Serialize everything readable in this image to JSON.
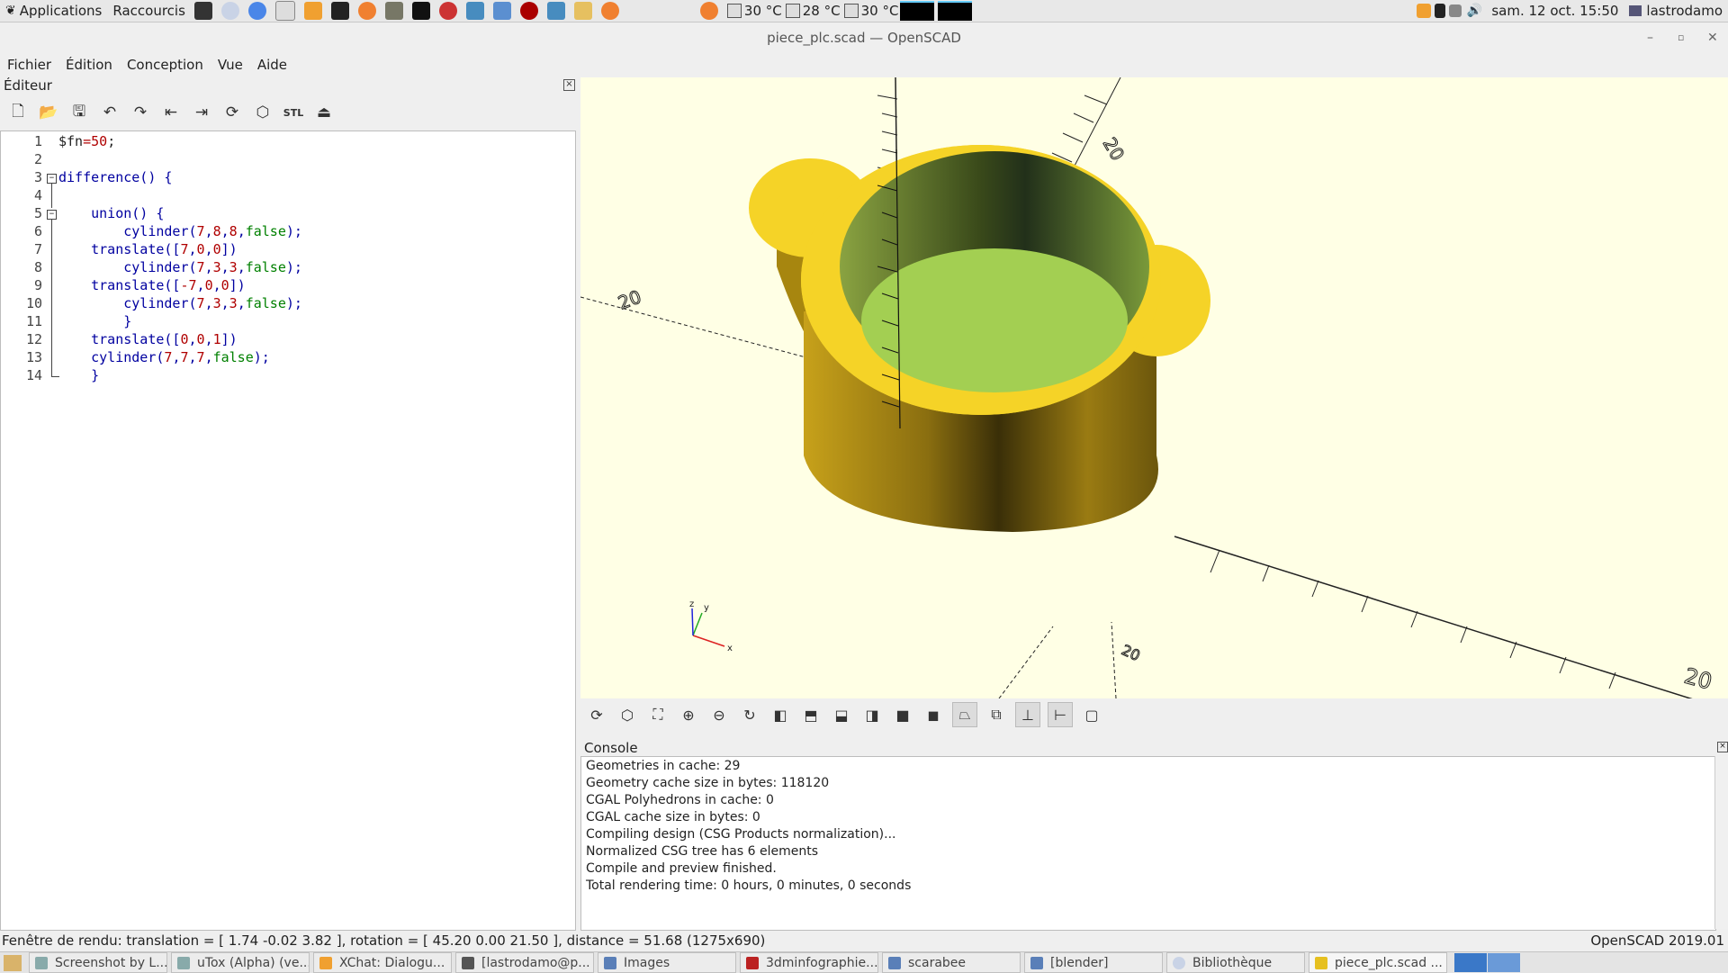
{
  "top_panel": {
    "applications": "Applications",
    "shortcuts": "Raccourcis",
    "temps": [
      "30 °C",
      "28 °C",
      "30 °C"
    ],
    "datetime": "sam. 12 oct.  15:50",
    "user": "lastrodamo"
  },
  "window": {
    "title": "piece_plc.scad — OpenSCAD"
  },
  "menubar": {
    "items": [
      "Fichier",
      "Édition",
      "Conception",
      "Vue",
      "Aide"
    ]
  },
  "editor": {
    "title": "Éditeur",
    "lines": [
      {
        "n": "1",
        "text": "$fn=50;"
      },
      {
        "n": "2",
        "text": ""
      },
      {
        "n": "3",
        "text": "difference() {"
      },
      {
        "n": "4",
        "text": ""
      },
      {
        "n": "5",
        "text": "    union() {"
      },
      {
        "n": "6",
        "text": "        cylinder(7,8,8,false);"
      },
      {
        "n": "7",
        "text": "    translate([7,0,0])"
      },
      {
        "n": "8",
        "text": "        cylinder(7,3,3,false);"
      },
      {
        "n": "9",
        "text": "    translate([-7,0,0])"
      },
      {
        "n": "10",
        "text": "        cylinder(7,3,3,false);"
      },
      {
        "n": "11",
        "text": "        }"
      },
      {
        "n": "12",
        "text": "    translate([0,0,1])"
      },
      {
        "n": "13",
        "text": "    cylinder(7,7,7,false);"
      },
      {
        "n": "14",
        "text": "    }"
      }
    ]
  },
  "viewport": {
    "axis_labels": {
      "x": "x",
      "y": "y",
      "z": "z"
    },
    "scale_labels": [
      "20",
      "20",
      "20",
      "20"
    ],
    "colors": {
      "background": "#ffffe5",
      "model_outer": "#f5d327",
      "model_inner": "#7f9a3a",
      "floor": "#a3cf52"
    }
  },
  "console": {
    "title": "Console",
    "lines": [
      "Geometries in cache: 29",
      "Geometry cache size in bytes: 118120",
      "CGAL Polyhedrons in cache: 0",
      "CGAL cache size in bytes: 0",
      "Compiling design (CSG Products normalization)...",
      "Normalized CSG tree has 6 elements",
      "Compile and preview finished.",
      "Total rendering time: 0 hours, 0 minutes, 0 seconds"
    ]
  },
  "status": {
    "left": "Fenêtre de rendu: translation = [ 1.74 -0.02 3.82 ], rotation = [ 45.20 0.00 21.50 ], distance = 51.68 (1275x690)",
    "right": "OpenSCAD 2019.01"
  },
  "taskbar": {
    "items": [
      "Screenshot by L...",
      "uTox (Alpha) (ve...",
      "XChat: Dialogu...",
      "[lastrodamo@p...",
      "Images",
      "3dminfographie...",
      "scarabee",
      "[blender]",
      "Bibliothèque",
      "piece_plc.scad ..."
    ]
  }
}
